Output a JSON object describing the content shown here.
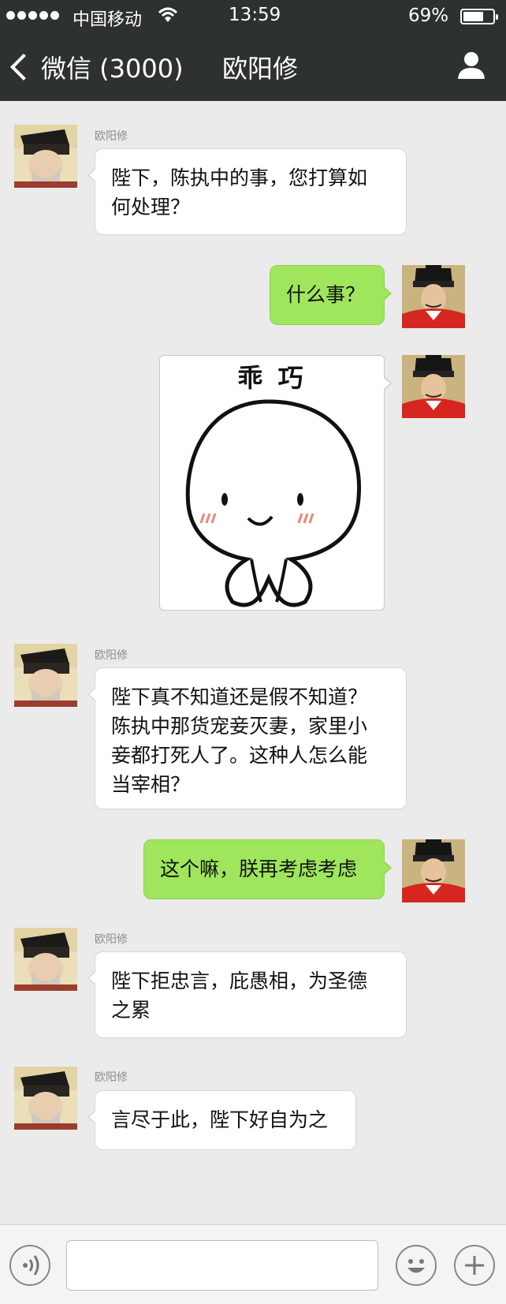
{
  "status_bar": {
    "carrier": "中国移动",
    "time": "13:59",
    "battery_percent": "69%",
    "battery_level": 0.69
  },
  "nav": {
    "back_label": "微信 (3000)",
    "title": "欧阳修"
  },
  "messages": [
    {
      "sender": "欧阳修",
      "side": "left",
      "text_lines": [
        "陛下，陈执中的事，您打算如",
        "何处理？"
      ]
    },
    {
      "side": "right",
      "text": "什么事？"
    },
    {
      "side": "right",
      "sticker_caption": "乖 巧"
    },
    {
      "sender": "欧阳修",
      "side": "left",
      "text_lines": [
        "陛下真不知道还是假不知道？",
        "陈执中那货宠妾灭妻，家里小",
        "妾都打死人了。这种人怎么能",
        "当宰相？"
      ]
    },
    {
      "side": "right",
      "text": "这个嘛，朕再考虑考虑"
    },
    {
      "sender": "欧阳修",
      "side": "left",
      "text_lines": [
        "陛下拒忠言，庇愚相，为圣德",
        "之累"
      ]
    },
    {
      "sender": "欧阳修",
      "side": "left",
      "text_lines": [
        "言尽于此，陛下好自为之"
      ]
    }
  ],
  "colors": {
    "nav_bg": "#2e3132",
    "chat_bg": "#ebebeb",
    "outgoing_bubble": "#9fe65c",
    "incoming_bubble": "#ffffff"
  },
  "icons": {
    "back": "chevron-left-icon",
    "profile": "person-icon",
    "voice": "voice-icon",
    "emoji": "emoji-icon",
    "plus": "plus-icon"
  }
}
